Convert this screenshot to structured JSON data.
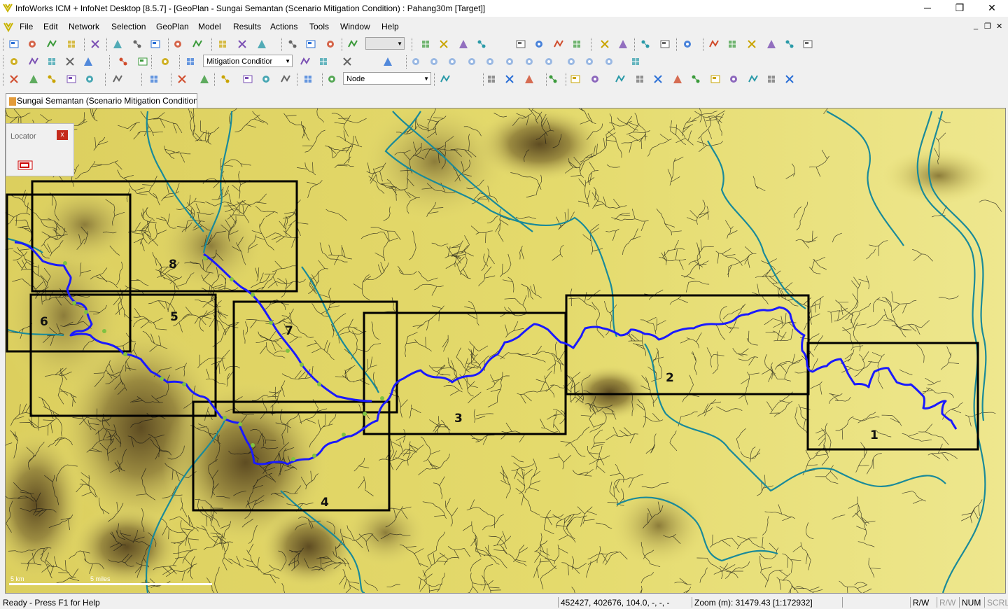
{
  "window": {
    "title": "InfoWorks ICM + InfoNet Desktop [8.5.7] - [GeoPlan - Sungai Semantan (Scenario Mitigation Condition) : Pahang30m  [Target]]",
    "minimize": "─",
    "maximize": "❐",
    "close": "✕"
  },
  "menu": [
    "File",
    "Edit",
    "Network",
    "Selection",
    "GeoPlan",
    "Model",
    "Results",
    "Actions",
    "Tools",
    "Window",
    "Help"
  ],
  "mdi_controls": {
    "minimize": "_",
    "restore": "❐",
    "close": "✕"
  },
  "toolbar": {
    "scenario_combo": "Mitigation Conditior",
    "object_type_combo": "Node",
    "blank_combo": ""
  },
  "document_tab": "Sungai Semantan (Scenario Mitigation Condition",
  "locator": {
    "title": "Locator",
    "close": "x"
  },
  "map": {
    "zone_labels": [
      "1",
      "2",
      "3",
      "4",
      "5",
      "6",
      "7",
      "8"
    ],
    "scale_bar": {
      "km": "5 km",
      "miles": "5 miles"
    },
    "colors": {
      "terrain_low": "#e6dd72",
      "terrain_high": "#6b5a28",
      "river_main": "#1a1aff",
      "river_secondary": "#1a8a99",
      "stream": "#111111",
      "zone_box": "#000000",
      "node": "#7fc241"
    }
  },
  "status": {
    "left": "Ready - Press F1 for Help",
    "coords": "452427, 402676, 104.0, -, -, -",
    "zoom": "Zoom (m): 31479.43 [1:172932]",
    "rw": "R/W",
    "rw2": "R/W",
    "num": "NUM",
    "scrl": "SCRL"
  }
}
